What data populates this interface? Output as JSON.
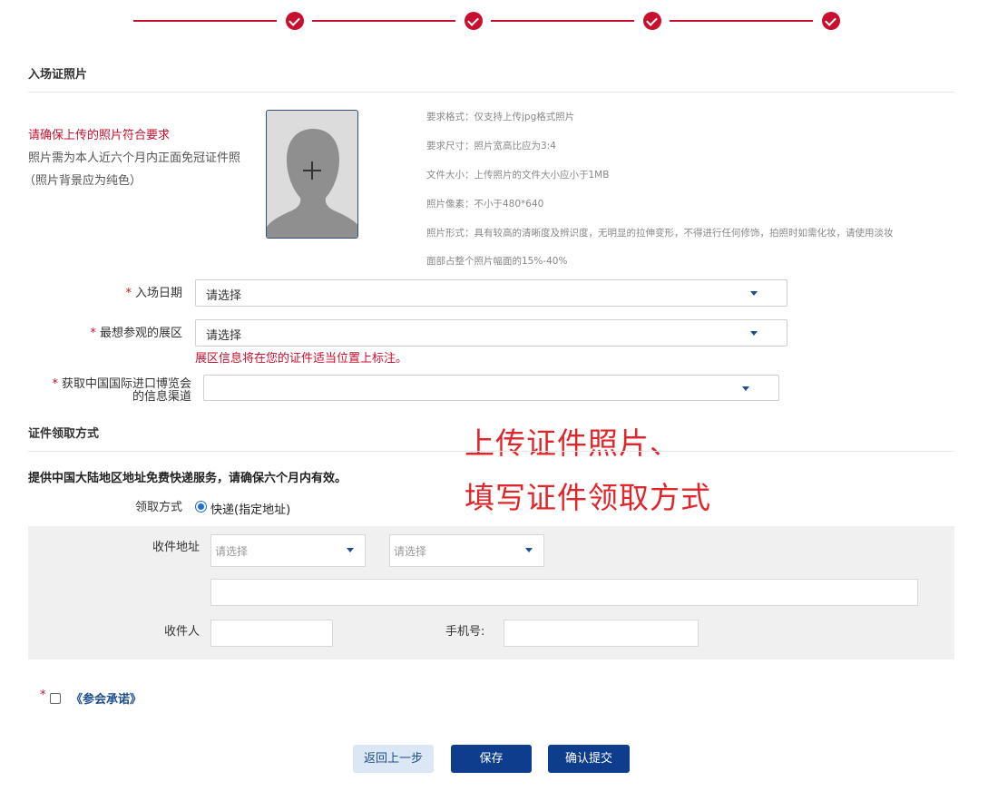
{
  "stepper": {
    "steps": 4,
    "color": "#c8102e"
  },
  "photo_section": {
    "title": "入场证照片",
    "warning": "请确保上传的照片符合要求",
    "note_line1": "照片需为本人近六个月内正面免冠证件照",
    "note_line2": "（照片背景应为纯色）",
    "requirements": [
      "要求格式：仅支持上传jpg格式照片",
      "要求尺寸：照片宽高比应为3:4",
      "文件大小：上传照片的文件大小应小于1MB",
      "照片像素：不小于480*640",
      "照片形式：具有较高的清晰度及辨识度，无明显的拉伸变形，不得进行任何修饰，拍照时如需化妆，请使用淡妆",
      "面部占整个照片幅面的15%-40%"
    ]
  },
  "form": {
    "entry_date": {
      "label": "入场日期",
      "value": "请选择"
    },
    "hall": {
      "label": "最想参观的展区",
      "value": "请选择",
      "hint": "展区信息将在您的证件适当位置上标注。"
    },
    "channel": {
      "label_line1": "获取中国国际进口博览会",
      "label_line2": "的信息渠道",
      "value": ""
    },
    "required_mark": "*"
  },
  "overlay": {
    "line1": "上传证件照片、",
    "line2": "填写证件领取方式"
  },
  "delivery": {
    "title": "证件领取方式",
    "notice": "提供中国大陆地区地址免费快递服务，请确保六个月内有效。",
    "method_label": "领取方式",
    "method_option": "快递(指定地址)",
    "address_label": "收件地址",
    "province_placeholder": "请选择",
    "city_placeholder": "请选择",
    "recipient_label": "收件人",
    "phone_label": "手机号:"
  },
  "agreement": {
    "link": "《参会承诺》"
  },
  "buttons": {
    "back": "返回上一步",
    "save": "保存",
    "submit": "确认提交"
  }
}
